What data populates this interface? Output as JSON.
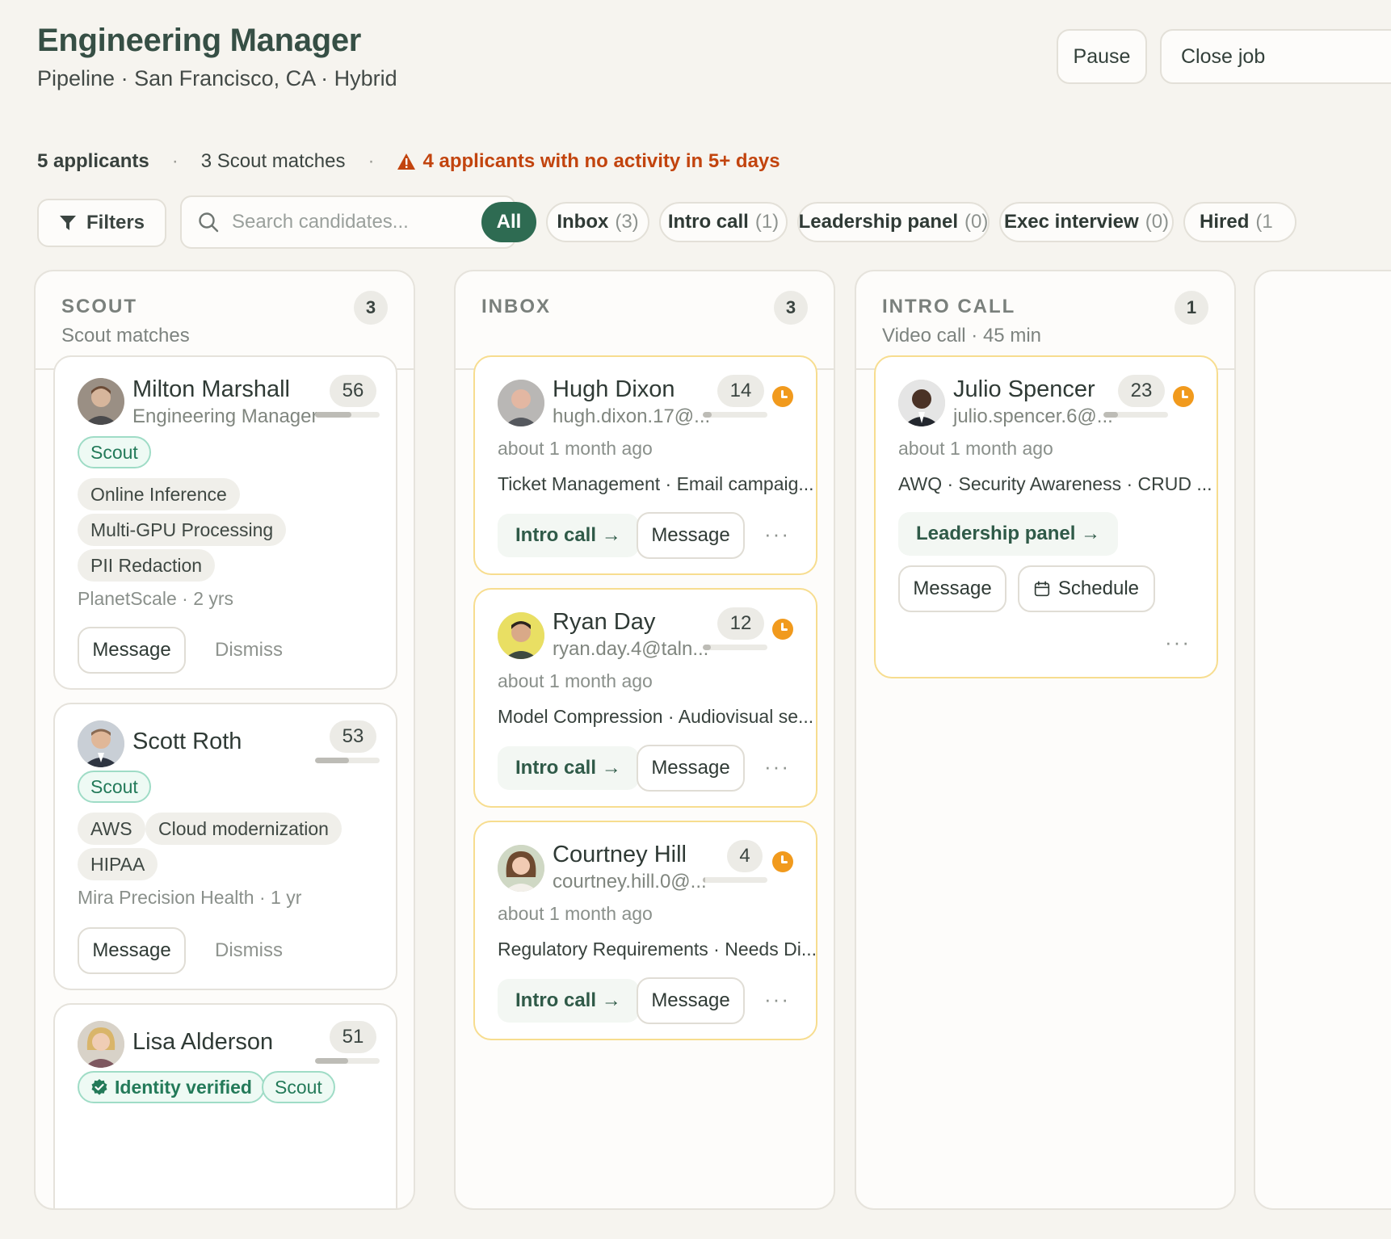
{
  "header": {
    "title": "Engineering Manager",
    "subtitle": "Pipeline · San Francisco, CA · Hybrid",
    "pause_label": "Pause",
    "close_label": "Close job"
  },
  "stats": {
    "applicants": "5 applicants",
    "scout_matches": "3 Scout matches",
    "warning": "4 applicants with no activity in 5+ days",
    "colors": {
      "warning": "#c2440e"
    }
  },
  "toolbar": {
    "filters_label": "Filters",
    "search_placeholder": "Search candidates...",
    "tabs": [
      {
        "label": "All",
        "count": ""
      },
      {
        "label": "Inbox",
        "count": "(3)"
      },
      {
        "label": "Intro call",
        "count": "(1)"
      },
      {
        "label": "Leadership panel",
        "count": "(0)"
      },
      {
        "label": "Exec interview",
        "count": "(0)"
      },
      {
        "label": "Hired",
        "count": "(1"
      }
    ],
    "colors": {
      "active_tab": "#2e6b52"
    }
  },
  "columns": {
    "scout": {
      "title": "SCOUT",
      "subtitle": "Scout matches",
      "count": "3",
      "cards": [
        {
          "name": "Milton Marshall",
          "role": "Engineering Manager",
          "score": "56",
          "score_level": 0.56,
          "badge": "Scout",
          "skills": [
            "Online Inference",
            "Multi-GPU Processing",
            "PII Redaction"
          ],
          "meta": "PlanetScale · 2 yrs",
          "message_label": "Message",
          "dismiss_label": "Dismiss"
        },
        {
          "name": "Scott Roth",
          "score": "53",
          "score_level": 0.53,
          "badge": "Scout",
          "skills": [
            "AWS",
            "Cloud modernization",
            "HIPAA"
          ],
          "meta": "Mira Precision Health · 1 yr",
          "message_label": "Message",
          "dismiss_label": "Dismiss"
        },
        {
          "name": "Lisa Alderson",
          "score": "51",
          "score_level": 0.51,
          "verified_label": "Identity verified",
          "badge": "Scout"
        }
      ]
    },
    "inbox": {
      "title": "INBOX",
      "count": "3",
      "cards": [
        {
          "name": "Hugh Dixon",
          "email": "hugh.dixon.17@...",
          "score": "14",
          "score_level": 0.14,
          "time": "about 1 month ago",
          "tags": "Ticket Management · Email campaig...",
          "stage_label": "Intro call →",
          "message_label": "Message",
          "more_label": "···"
        },
        {
          "name": "Ryan Day",
          "email": "ryan.day.4@taln...",
          "score": "12",
          "score_level": 0.12,
          "time": "about 1 month ago",
          "tags": "Model Compression · Audiovisual se...",
          "stage_label": "Intro call →",
          "message_label": "Message",
          "more_label": "···"
        },
        {
          "name": "Courtney Hill",
          "email": "courtney.hill.0@...",
          "score": "4",
          "score_level": 0.04,
          "time": "about 1 month ago",
          "tags": "Regulatory Requirements · Needs Di...",
          "stage_label": "Intro call →",
          "message_label": "Message",
          "more_label": "···"
        }
      ]
    },
    "intro_call": {
      "title": "INTRO CALL",
      "subtitle": "Video call · 45 min",
      "count": "1",
      "cards": [
        {
          "name": "Julio Spencer",
          "email": "julio.spencer.6@...",
          "score": "23",
          "score_level": 0.23,
          "time": "about 1 month ago",
          "tags": "AWQ · Security Awareness · CRUD ...",
          "stage_label": "Leadership panel →",
          "message_label": "Message",
          "schedule_label": "Schedule",
          "more_label": "···"
        }
      ]
    }
  },
  "icons": {
    "warning": "warning-triangle-icon",
    "filters": "funnel-icon",
    "search": "magnifier-icon",
    "stale": "clock-icon",
    "verified": "check-badge-icon",
    "schedule": "calendar-icon"
  }
}
